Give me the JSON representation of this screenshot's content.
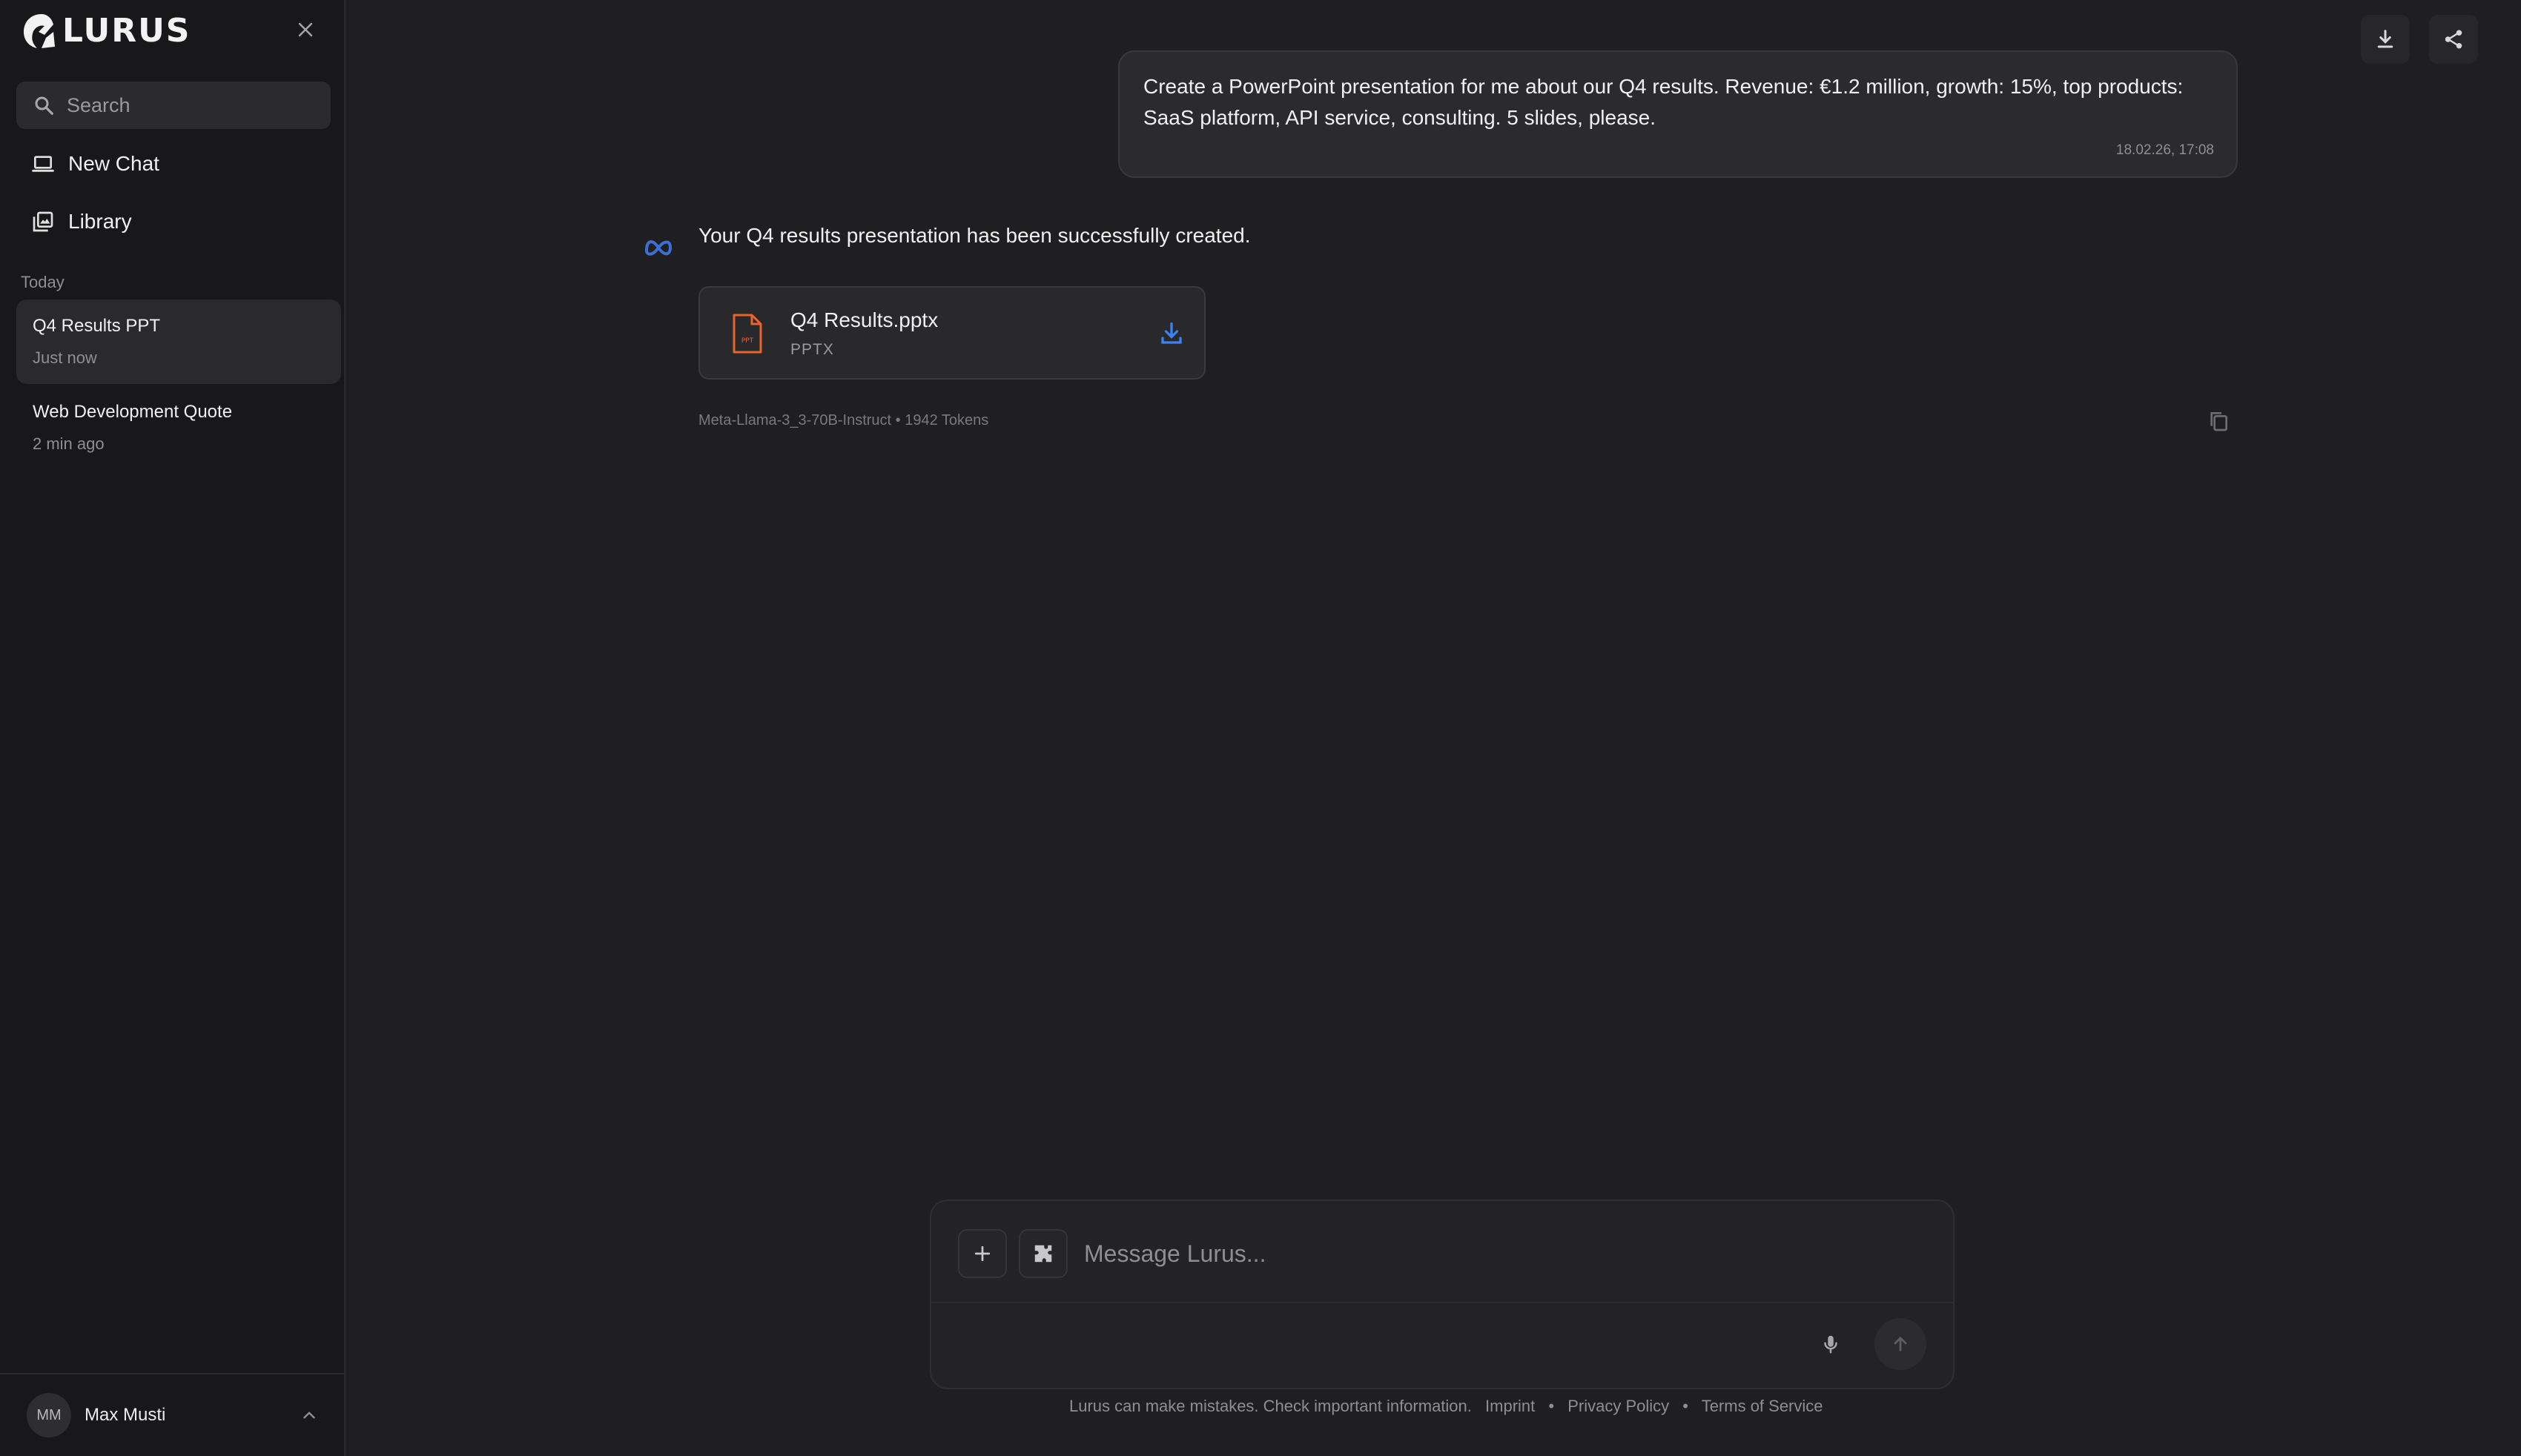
{
  "app": {
    "brand": "LURUS"
  },
  "sidebar": {
    "search": {
      "placeholder": "Search"
    },
    "nav": {
      "new_chat": "New Chat",
      "library": "Library"
    },
    "section_today": "Today",
    "chats": [
      {
        "title": "Q4 Results PPT",
        "time": "Just now"
      },
      {
        "title": "Web Development Quote",
        "time": "2 min ago"
      }
    ],
    "user": {
      "initials": "MM",
      "name": "Max Musti"
    }
  },
  "conversation": {
    "user_message": {
      "line1": "Create a PowerPoint presentation for me about our Q4 results. Revenue: €1.2 million, growth: 15%, top products:",
      "line2": "SaaS platform, API service, consulting. 5 slides, please.",
      "timestamp": "18.02.26, 17:08"
    },
    "assistant_message": {
      "text": "Your Q4 results presentation has been successfully created.",
      "file": {
        "name": "Q4 Results.pptx",
        "type": "PPTX",
        "icon_label": "PPT"
      },
      "meta": "Meta-Llama-3_3-70B-Instruct • 1942 Tokens"
    }
  },
  "composer": {
    "placeholder": "Message Lurus..."
  },
  "footer": {
    "disclaimer": "Lurus can make mistakes. Check important information.",
    "links": [
      "Imprint",
      "Privacy Policy",
      "Terms of Service"
    ],
    "separator": "•"
  },
  "colors": {
    "background": "#1f1f21",
    "sidebar": "#18181a",
    "file_accent": "#e8642c",
    "download_accent": "#3b82f6",
    "meta_icon": "#3b6fd6"
  },
  "icons": {
    "brand": "lurus-logo-icon",
    "close": "close-icon",
    "search": "search-icon",
    "new_chat": "laptop-icon",
    "library": "library-icon",
    "user_chevron": "chevron-up-icon",
    "download": "download-icon",
    "share": "share-icon",
    "assistant": "meta-logo-icon",
    "file": "pptx-file-icon",
    "file_download": "download-icon",
    "copy": "copy-icon",
    "plus": "plus-icon",
    "plugin": "puzzle-icon",
    "mic": "microphone-icon",
    "send": "arrow-up-icon"
  }
}
